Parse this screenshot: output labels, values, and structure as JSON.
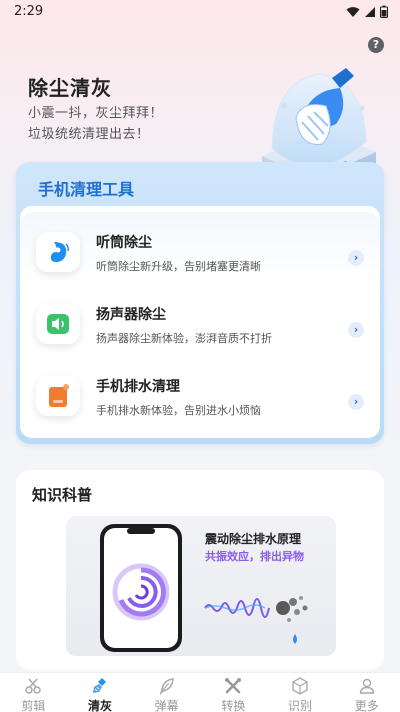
{
  "status": {
    "time": "2:29"
  },
  "hero": {
    "help_label": "?",
    "title": "除尘清灰",
    "subtitle_line1": "小震一抖，灰尘拜拜！",
    "subtitle_line2": "垃圾统统清理出去！"
  },
  "tools": {
    "title": "手机清理工具",
    "items": [
      {
        "name": "听筒除尘",
        "desc": "听筒除尘新升级，告别堵塞更清晰",
        "icon": "earpiece-icon"
      },
      {
        "name": "扬声器除尘",
        "desc": "扬声器除尘新体验，澎湃音质不打折",
        "icon": "speaker-icon"
      },
      {
        "name": "手机排水清理",
        "desc": "手机排水新体验，告别进水小烦恼",
        "icon": "water-drain-icon"
      }
    ]
  },
  "knowledge": {
    "title": "知识科普",
    "card_title": "震动除尘排水原理",
    "card_subtitle": "共振效应，排出异物"
  },
  "nav": {
    "items": [
      {
        "label": "剪辑",
        "icon": "scissors-icon",
        "active": false
      },
      {
        "label": "清灰",
        "icon": "brush-icon",
        "active": true
      },
      {
        "label": "弹幕",
        "icon": "feather-icon",
        "active": false
      },
      {
        "label": "转换",
        "icon": "tools-icon",
        "active": false
      },
      {
        "label": "识别",
        "icon": "cube-icon",
        "active": false
      },
      {
        "label": "更多",
        "icon": "person-icon",
        "active": false
      }
    ]
  },
  "colors": {
    "accent": "#1f6fd1",
    "tools_panel": "#c4e1fa",
    "card_subtitle": "#8a5cf0"
  }
}
